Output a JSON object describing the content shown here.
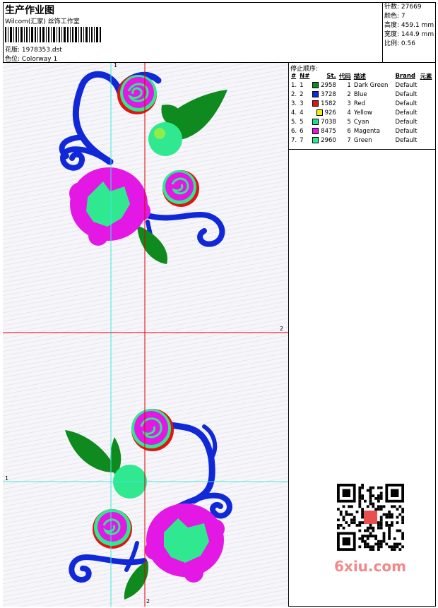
{
  "header": {
    "title": "生产作业图",
    "company": "Wilcom(汇家) 丝饰工作室",
    "file_label": "花版:",
    "file_value": "1978353.dst",
    "colorway_label": "色位:",
    "colorway_value": "Colorway 1"
  },
  "stats": [
    {
      "label": "针数:",
      "value": "27669"
    },
    {
      "label": "颜色:",
      "value": "7"
    },
    {
      "label": "高度:",
      "value": "459.1 mm"
    },
    {
      "label": "宽度:",
      "value": "144.9 mm"
    },
    {
      "label": "比例:",
      "value": "0.56"
    }
  ],
  "stop_sequence": {
    "title": "停止顺序:",
    "columns": [
      "#",
      "N#",
      "St.",
      "代码",
      "描述",
      "Brand",
      "元素"
    ],
    "rows": [
      {
        "index": "1.",
        "n": "1",
        "color": "#0f8a1e",
        "stitches": "2958",
        "code": "1",
        "desc": "Dark Green",
        "brand": "Default"
      },
      {
        "index": "2.",
        "n": "2",
        "color": "#1028d8",
        "stitches": "3728",
        "code": "2",
        "desc": "Blue",
        "brand": "Default"
      },
      {
        "index": "3.",
        "n": "3",
        "color": "#e01414",
        "stitches": "1582",
        "code": "3",
        "desc": "Red",
        "brand": "Default"
      },
      {
        "index": "4.",
        "n": "4",
        "color": "#f0f000",
        "stitches": "926",
        "code": "4",
        "desc": "Yellow",
        "brand": "Default"
      },
      {
        "index": "5.",
        "n": "5",
        "color": "#20e08a",
        "stitches": "7038",
        "code": "5",
        "desc": "Cyan",
        "brand": "Default"
      },
      {
        "index": "6.",
        "n": "6",
        "color": "#e418e4",
        "stitches": "8475",
        "code": "6",
        "desc": "Magenta",
        "brand": "Default"
      },
      {
        "index": "7.",
        "n": "7",
        "color": "#30e890",
        "stitches": "2960",
        "code": "7",
        "desc": "Green",
        "brand": "Default"
      }
    ]
  },
  "guides": {
    "cyan_label": "1",
    "red_label": "2"
  },
  "watermark": "6xiu.com",
  "colors": {
    "blue": "#1028d8",
    "magenta": "#e418e4",
    "green": "#0f8a1e",
    "cyan": "#30e890",
    "red": "#e01414",
    "guide_red": "#e00000",
    "guide_cyan": "#40e8d8"
  }
}
